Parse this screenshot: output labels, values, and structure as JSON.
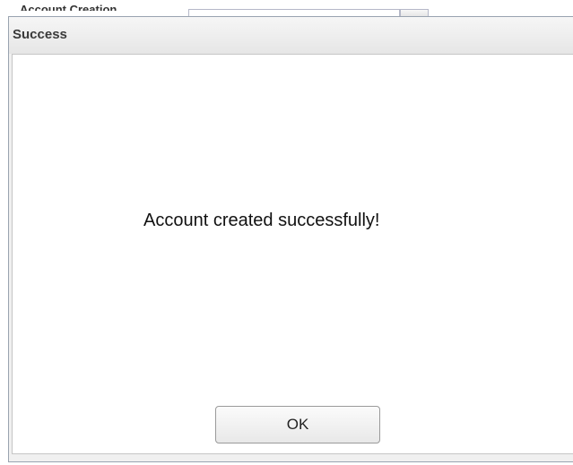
{
  "background_page": {
    "partial_label": "Account Creation"
  },
  "dialog": {
    "title": "Success",
    "message": "Account created successfully!",
    "ok_label": "OK"
  },
  "colors": {
    "header_gradient_top": "#f6f6f6",
    "header_gradient_bottom": "#e6e6e6",
    "border": "#99a3b0",
    "body_background": "#ffffff"
  }
}
